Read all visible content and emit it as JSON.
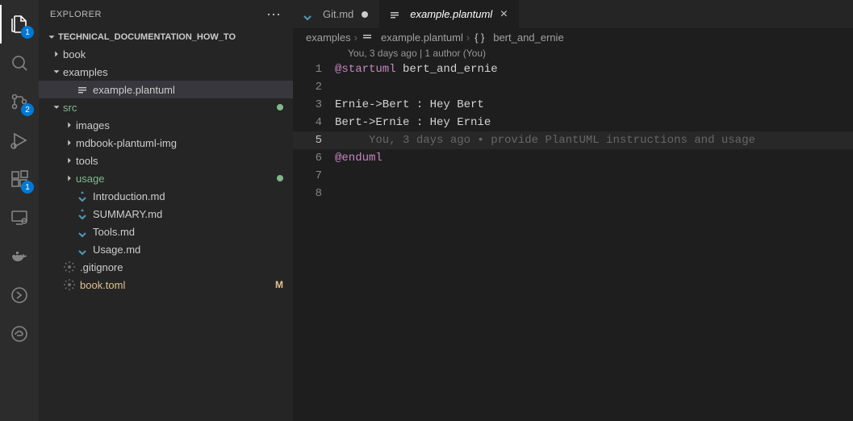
{
  "activity": {
    "badges": {
      "explorer": "1",
      "scm": "2",
      "extensions": "1"
    }
  },
  "sidebar": {
    "title": "EXPLORER",
    "section": "TECHNICAL_DOCUMENTATION_HOW_TO",
    "tree": {
      "book": "book",
      "examples": "examples",
      "example_file": "example.plantuml",
      "src": "src",
      "images": "images",
      "mdbook": "mdbook-plantuml-img",
      "tools": "tools",
      "usage": "usage",
      "intro": "Introduction.md",
      "summary": "SUMMARY.md",
      "toolsmd": "Tools.md",
      "usagemd": "Usage.md",
      "gitignore": ".gitignore",
      "booktoml": "book.toml",
      "booktoml_status": "M"
    }
  },
  "tabs": {
    "git": "Git.md",
    "example": "example.plantuml"
  },
  "breadcrumb": {
    "a": "examples",
    "b": "example.plantuml",
    "c": "bert_and_ernie"
  },
  "codelens": "You, 3 days ago | 1 author (You)",
  "lines": {
    "l1a": "@startuml",
    "l1b": " bert_and_ernie",
    "l2": "",
    "l3": "Ernie->Bert : Hey Bert",
    "l4": "Bert->Ernie : Hey Ernie",
    "l5ghost": "     You, 3 days ago • provide PlantUML instructions and usage",
    "l6": "@enduml",
    "n1": "1",
    "n2": "2",
    "n3": "3",
    "n4": "4",
    "n5": "5",
    "n6": "6",
    "n7": "7",
    "n8": "8"
  }
}
